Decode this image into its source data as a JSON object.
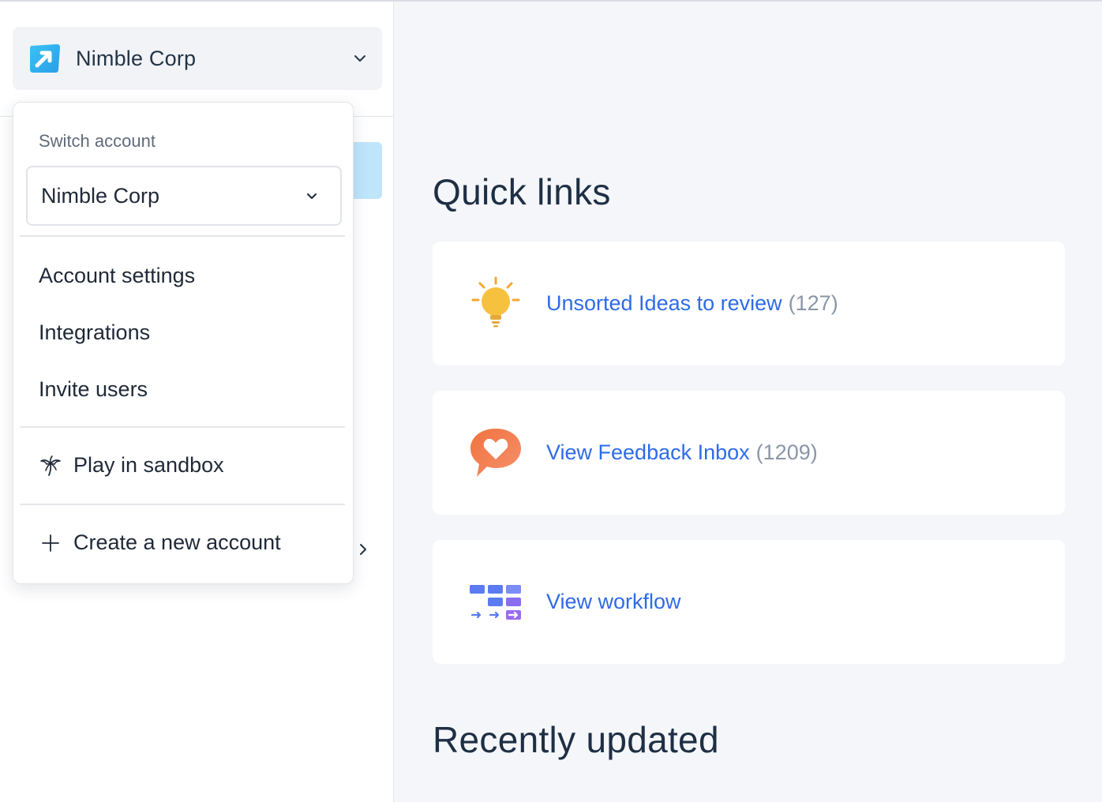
{
  "account": {
    "name": "Nimble Corp"
  },
  "dropdown": {
    "heading": "Switch account",
    "selected_account": "Nimble Corp",
    "items": {
      "account_settings": "Account settings",
      "integrations": "Integrations",
      "invite_users": "Invite users",
      "sandbox": "Play in sandbox",
      "create_account": "Create a new account"
    }
  },
  "main": {
    "quick_links_title": "Quick links",
    "quick_links": [
      {
        "label": "Unsorted Ideas to review",
        "count": "(127)",
        "icon": "lightbulb-icon"
      },
      {
        "label": "View Feedback Inbox",
        "count": "(1209)",
        "icon": "heart-chat-icon"
      },
      {
        "label": "View workflow",
        "count": "",
        "icon": "workflow-icon"
      }
    ],
    "recently_updated_title": "Recently updated"
  },
  "colors": {
    "link": "#2e6be6",
    "brand": "#2eb5f0",
    "active_highlight": "#bfe5fb"
  }
}
